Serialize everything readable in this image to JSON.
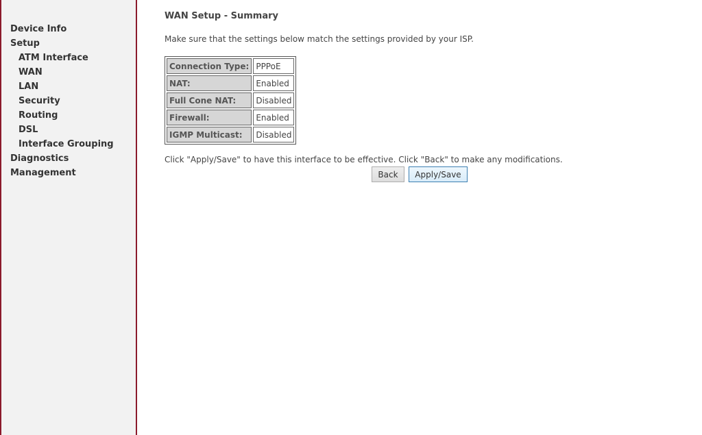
{
  "sidebar": {
    "items": [
      {
        "label": "Device Info",
        "level": 0
      },
      {
        "label": "Setup",
        "level": 0
      },
      {
        "label": "ATM Interface",
        "level": 1
      },
      {
        "label": "WAN",
        "level": 1
      },
      {
        "label": "LAN",
        "level": 1
      },
      {
        "label": "Security",
        "level": 1
      },
      {
        "label": "Routing",
        "level": 1
      },
      {
        "label": "DSL",
        "level": 1
      },
      {
        "label": "Interface Grouping",
        "level": 1
      },
      {
        "label": "Diagnostics",
        "level": 0
      },
      {
        "label": "Management",
        "level": 0
      }
    ]
  },
  "main": {
    "title": "WAN Setup - Summary",
    "intro": "Make sure that the settings below match the settings provided by your ISP.",
    "summary": [
      {
        "label": "Connection Type:",
        "value": "PPPoE"
      },
      {
        "label": "NAT:",
        "value": "Enabled"
      },
      {
        "label": "Full Cone NAT:",
        "value": "Disabled"
      },
      {
        "label": "Firewall:",
        "value": "Enabled"
      },
      {
        "label": "IGMP Multicast:",
        "value": "Disabled"
      }
    ],
    "note": "Click \"Apply/Save\" to have this interface to be effective. Click \"Back\" to make any modifications.",
    "buttons": {
      "back_label": "Back",
      "apply_label": "Apply/Save"
    }
  },
  "colors": {
    "sidebar_bg": "#f2f2f2",
    "sidebar_border": "#8b1a2b",
    "table_label_bg": "#d6d6d6",
    "apply_border": "#3c7fb1"
  }
}
